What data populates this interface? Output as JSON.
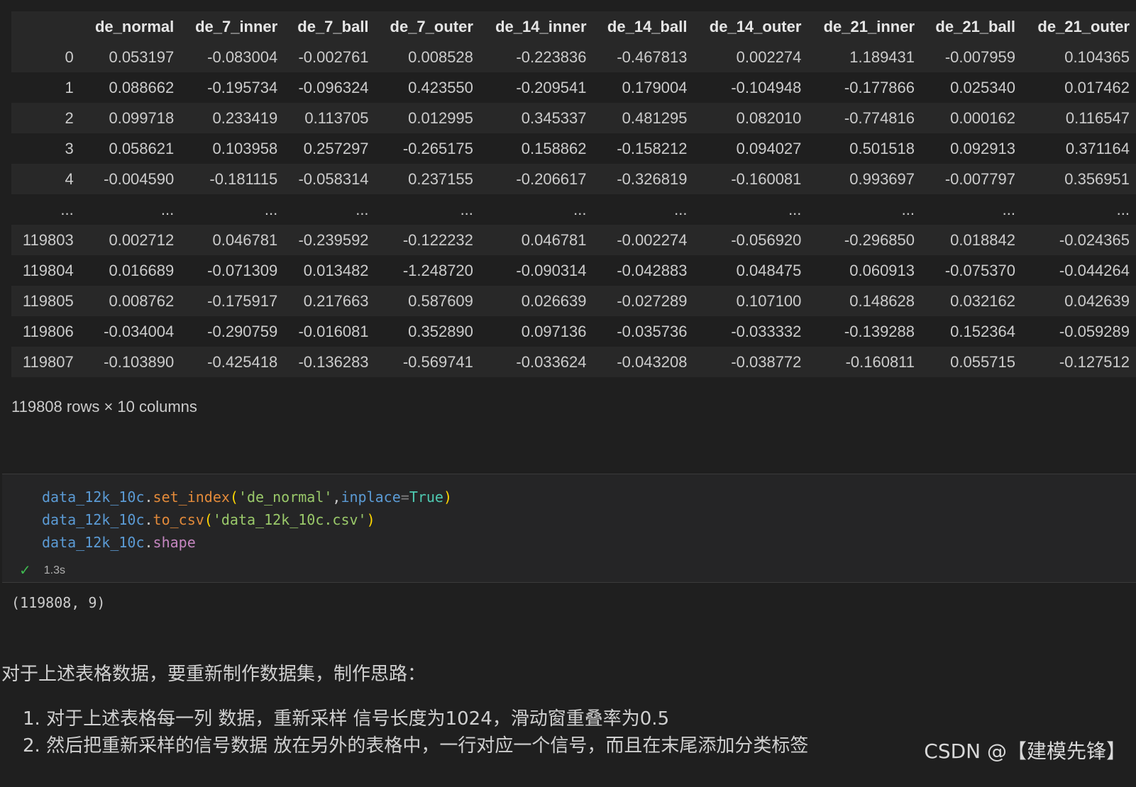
{
  "dataframe": {
    "columns": [
      "",
      "de_normal",
      "de_7_inner",
      "de_7_ball",
      "de_7_outer",
      "de_14_inner",
      "de_14_ball",
      "de_14_outer",
      "de_21_inner",
      "de_21_ball",
      "de_21_outer"
    ],
    "rows": [
      [
        "0",
        "0.053197",
        "-0.083004",
        "-0.002761",
        "0.008528",
        "-0.223836",
        "-0.467813",
        "0.002274",
        "1.189431",
        "-0.007959",
        "0.104365"
      ],
      [
        "1",
        "0.088662",
        "-0.195734",
        "-0.096324",
        "0.423550",
        "-0.209541",
        "0.179004",
        "-0.104948",
        "-0.177866",
        "0.025340",
        "0.017462"
      ],
      [
        "2",
        "0.099718",
        "0.233419",
        "0.113705",
        "0.012995",
        "0.345337",
        "0.481295",
        "0.082010",
        "-0.774816",
        "0.000162",
        "0.116547"
      ],
      [
        "3",
        "0.058621",
        "0.103958",
        "0.257297",
        "-0.265175",
        "0.158862",
        "-0.158212",
        "0.094027",
        "0.501518",
        "0.092913",
        "0.371164"
      ],
      [
        "4",
        "-0.004590",
        "-0.181115",
        "-0.058314",
        "0.237155",
        "-0.206617",
        "-0.326819",
        "-0.160081",
        "0.993697",
        "-0.007797",
        "0.356951"
      ],
      [
        "...",
        "...",
        "...",
        "...",
        "...",
        "...",
        "...",
        "...",
        "...",
        "...",
        "..."
      ],
      [
        "119803",
        "0.002712",
        "0.046781",
        "-0.239592",
        "-0.122232",
        "0.046781",
        "-0.002274",
        "-0.056920",
        "-0.296850",
        "0.018842",
        "-0.024365"
      ],
      [
        "119804",
        "0.016689",
        "-0.071309",
        "0.013482",
        "-1.248720",
        "-0.090314",
        "-0.042883",
        "0.048475",
        "0.060913",
        "-0.075370",
        "-0.044264"
      ],
      [
        "119805",
        "0.008762",
        "-0.175917",
        "0.217663",
        "0.587609",
        "0.026639",
        "-0.027289",
        "0.107100",
        "0.148628",
        "0.032162",
        "0.042639"
      ],
      [
        "119806",
        "-0.034004",
        "-0.290759",
        "-0.016081",
        "0.352890",
        "0.097136",
        "-0.035736",
        "-0.033332",
        "-0.139288",
        "0.152364",
        "-0.059289"
      ],
      [
        "119807",
        "-0.103890",
        "-0.425418",
        "-0.136283",
        "-0.569741",
        "-0.033624",
        "-0.043208",
        "-0.038772",
        "-0.160811",
        "0.055715",
        "-0.127512"
      ]
    ],
    "shape_note": "119808 rows × 10 columns"
  },
  "code_cell": {
    "lines": [
      [
        {
          "t": "data_12k_10c",
          "c": "var"
        },
        {
          "t": ".",
          "c": "punc"
        },
        {
          "t": "set_index",
          "c": "fn"
        },
        {
          "t": "(",
          "c": "paren"
        },
        {
          "t": "'de_normal'",
          "c": "str"
        },
        {
          "t": ",",
          "c": "punc"
        },
        {
          "t": "inplace",
          "c": "kw"
        },
        {
          "t": "=",
          "c": "op"
        },
        {
          "t": "True",
          "c": "const"
        },
        {
          "t": ")",
          "c": "paren"
        }
      ],
      [
        {
          "t": "data_12k_10c",
          "c": "var"
        },
        {
          "t": ".",
          "c": "punc"
        },
        {
          "t": "to_csv",
          "c": "fn"
        },
        {
          "t": "(",
          "c": "paren"
        },
        {
          "t": "'data_12k_10c.csv'",
          "c": "str"
        },
        {
          "t": ")",
          "c": "paren"
        }
      ],
      [
        {
          "t": "data_12k_10c",
          "c": "var"
        },
        {
          "t": ".",
          "c": "punc"
        },
        {
          "t": "shape",
          "c": "attr"
        }
      ]
    ],
    "status_icon": "check-icon",
    "exec_time": "1.3s",
    "output": "(119808, 9)"
  },
  "markdown": {
    "paragraph": "对于上述表格数据，要重新制作数据集，制作思路：",
    "list": [
      "1. 对于上述表格每一列 数据，重新采样 信号长度为1024，滑动窗重叠率为0.5",
      "2. 然后把重新采样的信号数据 放在另外的表格中，一行对应一个信号，而且在末尾添加分类标签"
    ]
  },
  "watermark": "CSDN @【建模先锋】",
  "colors": {
    "background": "#1f1f1f",
    "row_stripe": "#282828",
    "success_check": "#3fb950"
  }
}
